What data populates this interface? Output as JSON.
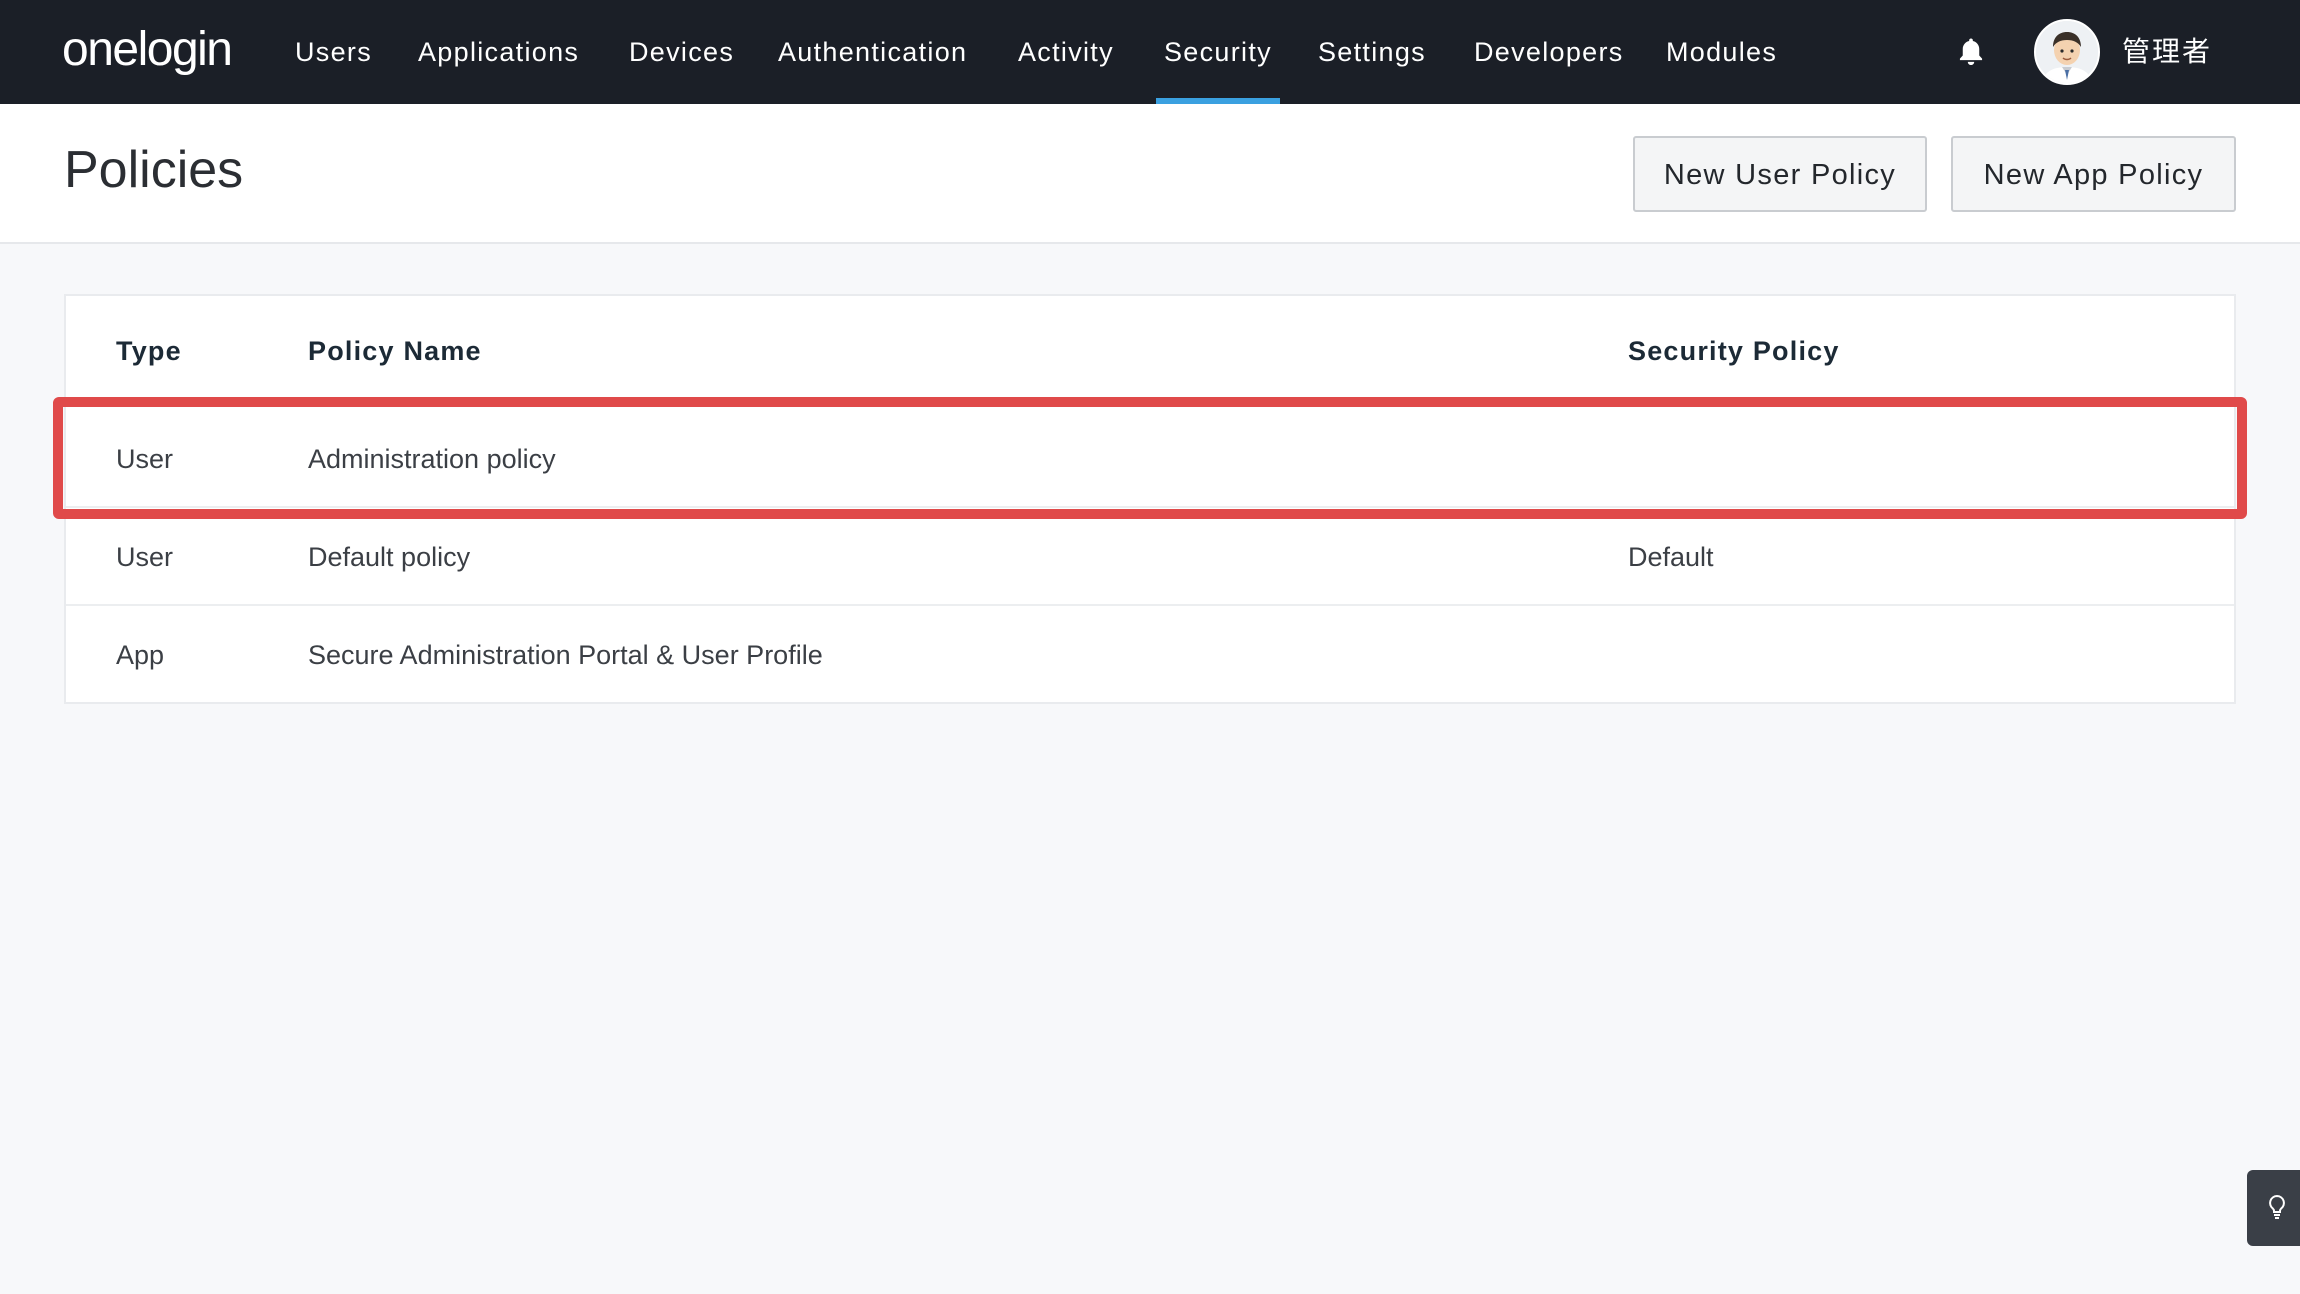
{
  "nav": {
    "logo": "onelogin",
    "items": [
      {
        "label": "Users"
      },
      {
        "label": "Applications"
      },
      {
        "label": "Devices"
      },
      {
        "label": "Authentication"
      },
      {
        "label": "Activity"
      },
      {
        "label": "Security"
      },
      {
        "label": "Settings"
      },
      {
        "label": "Developers"
      },
      {
        "label": "Modules"
      }
    ],
    "active": "Security",
    "bell_icon": "bell-icon",
    "avatar_icon": "avatar",
    "user_name": "管理者"
  },
  "header": {
    "title": "Policies",
    "new_user_policy": "New User Policy",
    "new_app_policy": "New App Policy"
  },
  "table": {
    "columns": [
      "Type",
      "Policy Name",
      "Security Policy"
    ],
    "rows": [
      {
        "type": "User",
        "name": "Administration policy",
        "security": ""
      },
      {
        "type": "User",
        "name": "Default policy",
        "security": "Default"
      },
      {
        "type": "App",
        "name": "Secure Administration Portal & User Profile",
        "security": ""
      }
    ]
  },
  "colors": {
    "nav_bg": "#1b1f27",
    "active_underline": "#3aa0e0",
    "highlight": "#e04a4a"
  },
  "help_icon": "lightbulb-icon"
}
